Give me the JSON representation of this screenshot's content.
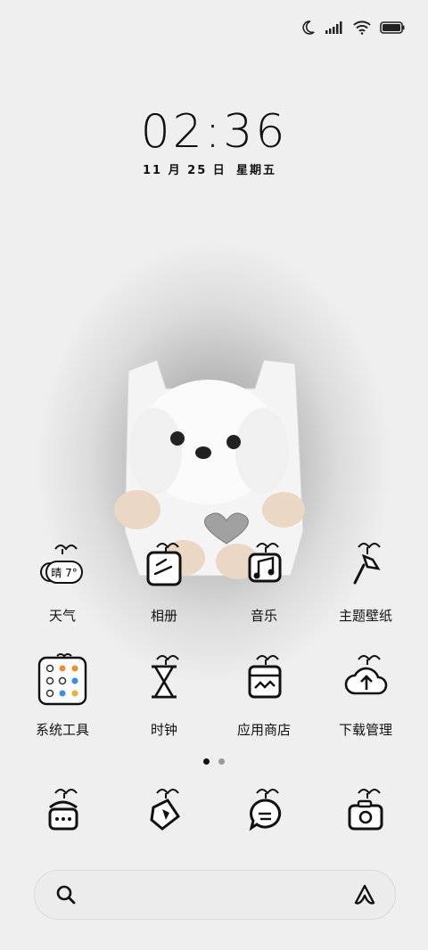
{
  "status": {
    "icons": [
      "moon-icon",
      "signal-icon",
      "wifi-icon",
      "battery-icon"
    ]
  },
  "clock": {
    "time": "02:36",
    "date_month": "11",
    "date_month_unit": "月",
    "date_day": "25",
    "date_day_unit": "日",
    "weekday": "星期五"
  },
  "apps_row1": [
    {
      "label": "天气",
      "icon": "weather-icon",
      "badge": "晴 7°"
    },
    {
      "label": "相册",
      "icon": "gallery-icon"
    },
    {
      "label": "音乐",
      "icon": "music-icon"
    },
    {
      "label": "主题壁纸",
      "icon": "theme-brush-icon"
    }
  ],
  "apps_row2": [
    {
      "label": "系统工具",
      "icon": "folder-icon"
    },
    {
      "label": "时钟",
      "icon": "hourglass-icon"
    },
    {
      "label": "应用商店",
      "icon": "store-icon"
    },
    {
      "label": "下载管理",
      "icon": "download-cloud-icon"
    }
  ],
  "dock": [
    {
      "icon": "phone-icon"
    },
    {
      "icon": "browser-icon"
    },
    {
      "icon": "message-icon"
    },
    {
      "icon": "camera-icon"
    }
  ],
  "page_indicator": {
    "pages": 2,
    "current": 1
  },
  "search": {
    "icon": "search-icon",
    "assistant_icon": "assistant-icon"
  }
}
